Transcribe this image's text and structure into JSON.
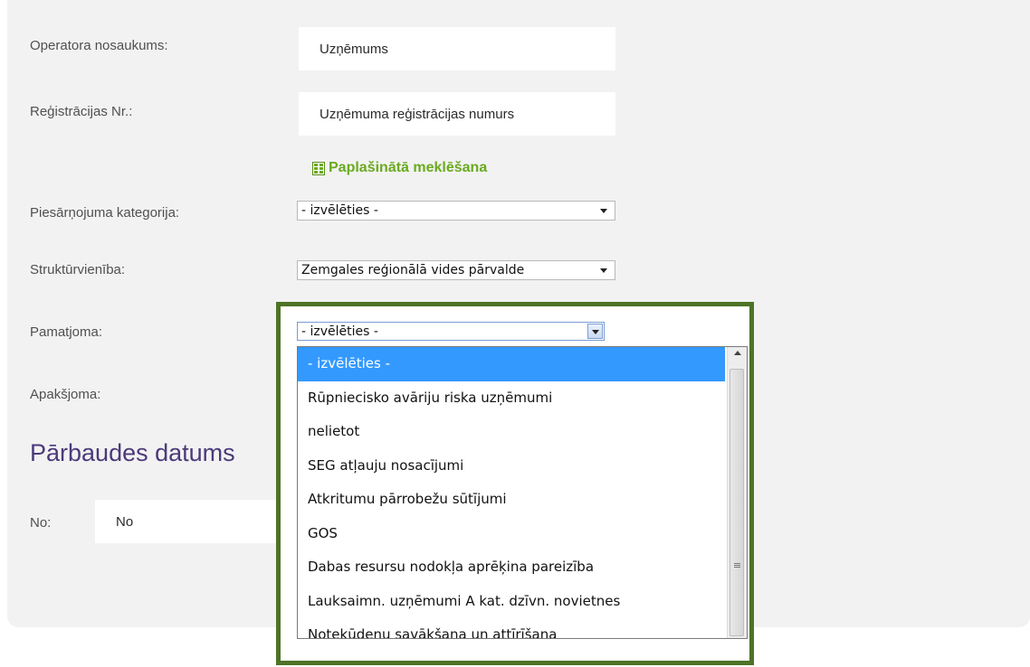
{
  "form": {
    "operator_label": "Operatora nosaukums:",
    "operator_placeholder": "Uzņēmums",
    "reg_label": "Reģistrācijas Nr.:",
    "reg_placeholder": "Uzņēmuma reģistrācijas numurs",
    "advanced_search": "Paplašinātā meklēšana",
    "pollution_label": "Piesārņojuma kategorija:",
    "pollution_value": "- izvēlēties -",
    "structural_label": "Struktūrvienība:",
    "structural_value": "Zemgales reģionālā vides pārvalde",
    "main_area_label": "Pamatjoma:",
    "main_area_value": "- izvēlēties -",
    "sub_area_label": "Apakšjoma:",
    "date_heading": "Pārbaudes datums",
    "from_label": "No:",
    "from_placeholder": "No"
  },
  "dropdown": {
    "options": [
      "- izvēlēties -",
      "Rūpniecisko avāriju riska uzņēmumi",
      "nelietot",
      "SEG atļauju nosacījumi",
      "Atkritumu pārrobežu sūtījumi",
      "GOS",
      "Dabas resursu nodokļa aprēķina pareizība",
      "Lauksaimn. uzņēmumi A kat. dzīvn. novietnes",
      "Notekūdenu savākšana un attīrīšana"
    ],
    "selected_index": 0
  },
  "colors": {
    "accent_green": "#6aaa1f",
    "frame_green": "#4e7326",
    "heading_purple": "#4b3a7a",
    "selection_blue": "#3399ff"
  }
}
